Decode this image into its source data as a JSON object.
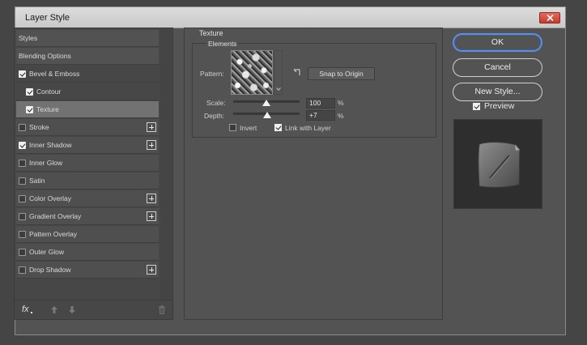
{
  "window": {
    "title": "Layer Style"
  },
  "styles_panel": {
    "items": [
      {
        "label": "Styles",
        "checkbox": false,
        "checked": false,
        "plus": false
      },
      {
        "label": "Blending Options",
        "checkbox": false,
        "checked": false,
        "plus": false
      },
      {
        "label": "Bevel & Emboss",
        "checkbox": true,
        "checked": true,
        "plus": false
      },
      {
        "label": "Contour",
        "checkbox": true,
        "checked": true,
        "plus": false
      },
      {
        "label": "Texture",
        "checkbox": true,
        "checked": true,
        "plus": false
      },
      {
        "label": "Stroke",
        "checkbox": true,
        "checked": false,
        "plus": true
      },
      {
        "label": "Inner Shadow",
        "checkbox": true,
        "checked": true,
        "plus": true
      },
      {
        "label": "Inner Glow",
        "checkbox": true,
        "checked": false,
        "plus": false
      },
      {
        "label": "Satin",
        "checkbox": true,
        "checked": false,
        "plus": false
      },
      {
        "label": "Color Overlay",
        "checkbox": true,
        "checked": false,
        "plus": true
      },
      {
        "label": "Gradient Overlay",
        "checkbox": true,
        "checked": false,
        "plus": true
      },
      {
        "label": "Pattern Overlay",
        "checkbox": true,
        "checked": false,
        "plus": false
      },
      {
        "label": "Outer Glow",
        "checkbox": true,
        "checked": false,
        "plus": false
      },
      {
        "label": "Drop Shadow",
        "checkbox": true,
        "checked": false,
        "plus": true
      }
    ],
    "selected_item": "Texture",
    "fx_label": "fx"
  },
  "texture": {
    "group_title": "Texture",
    "sub_title": "Elements",
    "pattern_label": "Pattern:",
    "snap_button": "Snap to Origin",
    "scale_label": "Scale:",
    "scale_value": "100",
    "scale_unit": "%",
    "scale_level": 0.5,
    "depth_label": "Depth:",
    "depth_value": "+7",
    "depth_unit": "%",
    "depth_level": 0.51,
    "invert_label": "Invert",
    "invert_checked": false,
    "link_label": "Link with Layer",
    "link_checked": true
  },
  "actions": {
    "ok": "OK",
    "cancel": "Cancel",
    "new_style": "New Style...",
    "preview_label": "Preview",
    "preview_checked": true
  },
  "icons": {
    "close": "close-icon",
    "fx": "fx-icon",
    "move_up": "arrow-up-icon",
    "move_down": "arrow-down-icon",
    "delete": "trash-icon",
    "snap_origin": "snap-origin-icon",
    "pattern_menu": "chevron-down-icon"
  },
  "colors": {
    "dialog_bg": "#535353",
    "selected_row": "#727272",
    "ok_focus_border": "#5d8fdc",
    "close_button": "#d04a3c"
  }
}
